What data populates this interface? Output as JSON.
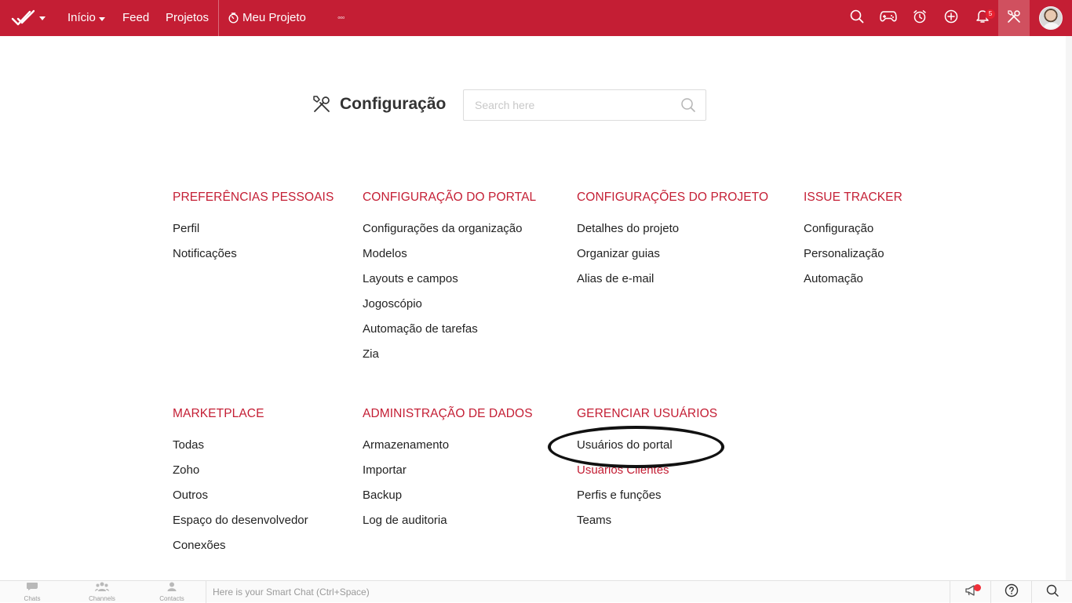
{
  "colors": {
    "brand": "#c41e34",
    "section_heading": "#c41e34",
    "link_text": "#222222"
  },
  "topbar": {
    "logo_icon": "double-check-logo-icon",
    "nav": [
      {
        "label": "Início",
        "has_dropdown": true
      },
      {
        "label": "Feed"
      },
      {
        "label": "Projetos"
      },
      {
        "label": "Meu Projeto",
        "icon": "timer-icon"
      }
    ],
    "more_label": "◦◦◦",
    "icons": [
      "search-icon",
      "gamepad-icon",
      "alarm-clock-icon",
      "add-circle-icon",
      "bell-icon",
      "tools-icon",
      "avatar"
    ],
    "notification_count": "5"
  },
  "page": {
    "title": "Configuração",
    "title_icon": "tools-icon",
    "search": {
      "placeholder": "Search here",
      "value": ""
    }
  },
  "sections": {
    "personal": {
      "heading": "PREFERÊNCIAS PESSOAIS",
      "items": [
        "Perfil",
        "Notificações"
      ]
    },
    "portal": {
      "heading": "CONFIGURAÇÃO DO PORTAL",
      "items": [
        "Configurações da organização",
        "Modelos",
        "Layouts e campos",
        "Jogoscópio",
        "Automação de tarefas",
        "Zia"
      ]
    },
    "project": {
      "heading": "CONFIGURAÇÕES DO PROJETO",
      "items": [
        "Detalhes do projeto",
        "Organizar guias",
        "Alias de e-mail"
      ]
    },
    "issue": {
      "heading": "ISSUE TRACKER",
      "items": [
        "Configuração",
        "Personalização",
        "Automação"
      ]
    },
    "marketplace": {
      "heading": "MARKETPLACE",
      "items": [
        "Todas",
        "Zoho",
        "Outros",
        "Espaço do desenvolvedor",
        "Conexões"
      ]
    },
    "data_admin": {
      "heading": "ADMINISTRAÇÃO DE DADOS",
      "items": [
        "Armazenamento",
        "Importar",
        "Backup",
        "Log de auditoria"
      ]
    },
    "users": {
      "heading": "GERENCIAR USUÁRIOS",
      "items": [
        "Usuários do portal",
        "Usuários Clientes",
        "Perfis e funções",
        "Teams"
      ],
      "highlighted_index": 1,
      "circled_index": 0
    }
  },
  "bottombar": {
    "tabs": [
      {
        "label": "Chats",
        "icon": "chat-bubble-icon"
      },
      {
        "label": "Channels",
        "icon": "channels-icon"
      },
      {
        "label": "Contacts",
        "icon": "contact-icon"
      }
    ],
    "smart_chat_placeholder": "Here is your Smart Chat (Ctrl+Space)",
    "right_icons": [
      "megaphone-icon",
      "help-icon",
      "search-icon"
    ]
  }
}
